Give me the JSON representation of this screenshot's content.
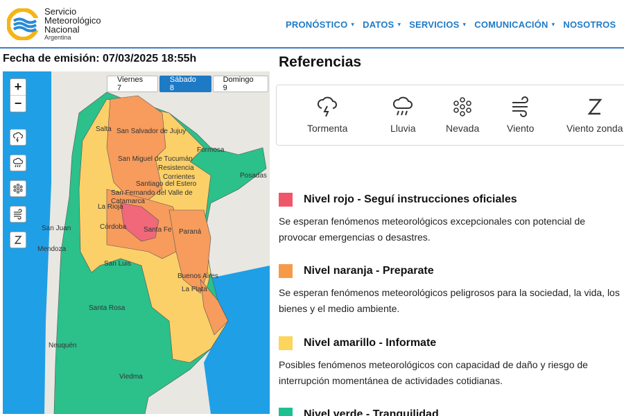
{
  "header": {
    "logo_lines": [
      "Servicio",
      "Meteorológico",
      "Nacional"
    ],
    "logo_sub": "Argentina",
    "nav": [
      {
        "label": "PRONÓSTICO",
        "caret": "▾"
      },
      {
        "label": "DATOS",
        "caret": "▾"
      },
      {
        "label": "SERVICIOS",
        "caret": "▾"
      },
      {
        "label": "COMUNICACIÓN",
        "caret": "▾"
      },
      {
        "label": "NOSOTROS",
        "caret": ""
      }
    ]
  },
  "emission": "Fecha de emisión: 07/03/2025 18:55h",
  "map": {
    "zoom_in": "+",
    "zoom_out": "−",
    "days": [
      "Viernes 7",
      "Sábado 8",
      "Domingo 9"
    ],
    "active_day": "Sábado 8",
    "tools": [
      "storm-icon",
      "rain-icon",
      "snow-icon",
      "wind-icon",
      "zonda-icon"
    ],
    "cities": [
      "Salta",
      "San Salvador de Jujuy",
      "Formosa",
      "San Miguel de Tucumán",
      "Resistencia",
      "Corrientes",
      "Posadas",
      "Santiago del Estero",
      "San Fernando del Valle de Catamarca",
      "La Rioja",
      "San Juan",
      "Córdoba",
      "Santa Fe",
      "Paraná",
      "Mendoza",
      "San Luis",
      "Buenos Aires",
      "La Plata",
      "Santa Rosa",
      "Neuquén",
      "Viedma"
    ],
    "colors": {
      "green": "#2cc08a",
      "yellow": "#fcd068",
      "orange": "#f79c5c",
      "red": "#f0687a",
      "sea": "#1f9fe6",
      "land": "#e9e7e2"
    }
  },
  "references": {
    "title": "Referencias",
    "items": [
      {
        "label": "Tormenta",
        "icon": "storm-icon"
      },
      {
        "label": "Lluvia",
        "icon": "rain-icon"
      },
      {
        "label": "Nevada",
        "icon": "snow-icon"
      },
      {
        "label": "Viento",
        "icon": "wind-icon"
      },
      {
        "label": "Viento zonda",
        "icon": "zonda-icon"
      }
    ]
  },
  "levels": [
    {
      "color": "#f0566a",
      "title": "Nivel rojo - Seguí instrucciones oficiales",
      "desc": "Se esperan fenómenos meteorológicos excepcionales con potencial de provocar emergencias o desastres."
    },
    {
      "color": "#f79a48",
      "title": "Nivel naranja - Preparate",
      "desc": "Se esperan fenómenos meteorológicos peligrosos para la sociedad, la vida, los bienes y el medio ambiente."
    },
    {
      "color": "#fdd45c",
      "title": "Nivel amarillo - Informate",
      "desc": "Posibles fenómenos meteorológicos con capacidad de daño y riesgo de interrupción momentánea de actividades cotidianas."
    },
    {
      "color": "#1ec08f",
      "title": "Nivel verde - Tranquilidad",
      "desc": ""
    }
  ]
}
